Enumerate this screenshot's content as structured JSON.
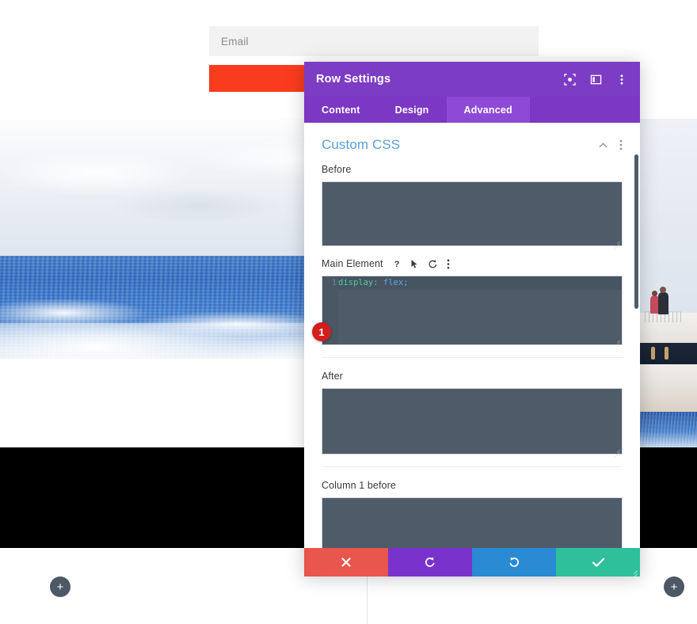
{
  "background_page": {
    "email_input": {
      "placeholder": "Email",
      "value": ""
    },
    "cta_button": {
      "label": "",
      "color": "#fa3c1e"
    },
    "add_section_left": {
      "label": "+"
    },
    "add_section_right": {
      "label": "+"
    }
  },
  "modal": {
    "title": "Row Settings",
    "header_icons": [
      {
        "name": "fullscreen-icon"
      },
      {
        "name": "layout-toggle-icon"
      },
      {
        "name": "more-options-icon"
      }
    ],
    "tabs": [
      {
        "label": "Content",
        "active": false
      },
      {
        "label": "Design",
        "active": false
      },
      {
        "label": "Advanced",
        "active": true
      }
    ],
    "section": {
      "title": "Custom CSS",
      "collapse_icon": "chevron-up-icon",
      "more_icon": "more-options-icon"
    },
    "fields": [
      {
        "label": "Before",
        "value": "",
        "icons": []
      },
      {
        "label": "Main Element",
        "value": "display: flex;",
        "code": {
          "line_number": "1",
          "property": "display:",
          "value": "flex;"
        },
        "icons": [
          {
            "name": "help-icon"
          },
          {
            "name": "cursor-icon"
          },
          {
            "name": "reset-icon"
          },
          {
            "name": "more-options-icon"
          }
        ],
        "badge": "1"
      },
      {
        "label": "After",
        "value": "",
        "icons": []
      },
      {
        "label": "Column 1 before",
        "value": "",
        "icons": []
      }
    ],
    "footer_buttons": [
      {
        "name": "cancel-button",
        "icon": "close-icon",
        "color": "#e9564d"
      },
      {
        "name": "undo-button",
        "icon": "undo-icon",
        "color": "#7a32cc"
      },
      {
        "name": "redo-button",
        "icon": "redo-icon",
        "color": "#2a8ad4"
      },
      {
        "name": "save-button",
        "icon": "check-icon",
        "color": "#2fbf9a"
      }
    ]
  },
  "colors": {
    "modal_header": "#7d3cc4",
    "tab_active": "#8d4ad6",
    "section_title": "#5b9dd9",
    "textarea": "#4e5c6a",
    "badge": "#d31e1e"
  }
}
